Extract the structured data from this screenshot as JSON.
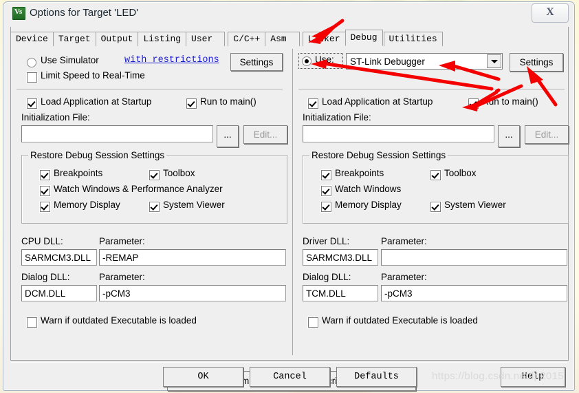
{
  "window": {
    "title": "Options for Target 'LED'",
    "icon": "keil-uvision-icon",
    "close_label": "X"
  },
  "tabs": [
    {
      "label": "Device",
      "selected": false
    },
    {
      "label": "Target",
      "selected": false
    },
    {
      "label": "Output",
      "selected": false
    },
    {
      "label": "Listing",
      "selected": false
    },
    {
      "label": "User",
      "selected": false
    },
    {
      "label": "C/C++",
      "selected": false
    },
    {
      "label": "Asm",
      "selected": false
    },
    {
      "label": "Linker",
      "selected": false
    },
    {
      "label": "Debug",
      "selected": true
    },
    {
      "label": "Utilities",
      "selected": false
    }
  ],
  "left": {
    "use_simulator_label": "Use Simulator",
    "use_simulator_checked": false,
    "restrictions_link": "with restrictions",
    "settings_button": "Settings",
    "limit_speed_label": "Limit Speed to Real-Time",
    "limit_speed_checked": false,
    "load_app_label": "Load Application at Startup",
    "load_app_checked": true,
    "run_to_main_label": "Run to main()",
    "run_to_main_checked": true,
    "init_file_label": "Initialization File:",
    "init_file_value": "",
    "browse_button": "...",
    "edit_button": "Edit...",
    "restore_group_title": "Restore Debug Session Settings",
    "restore_items": [
      {
        "label": "Breakpoints",
        "checked": true
      },
      {
        "label": "Toolbox",
        "checked": true
      },
      {
        "label": "Watch Windows & Performance Analyzer",
        "checked": true
      },
      {
        "label": "Memory Display",
        "checked": true
      },
      {
        "label": "System Viewer",
        "checked": true
      }
    ],
    "cpu_dll_label": "CPU DLL:",
    "cpu_dll_value": "SARMCM3.DLL",
    "cpu_param_label": "Parameter:",
    "cpu_param_value": "-REMAP",
    "dialog_dll_label": "Dialog DLL:",
    "dialog_dll_value": "DCM.DLL",
    "dialog_param_label": "Parameter:",
    "dialog_param_value": "-pCM3",
    "warn_label": "Warn if outdated Executable is loaded",
    "warn_checked": false
  },
  "right": {
    "use_label": "Use:",
    "use_checked": true,
    "debugger_selected": "ST-Link Debugger",
    "settings_button": "Settings",
    "load_app_label": "Load Application at Startup",
    "load_app_checked": true,
    "run_to_main_label": "Run to main()",
    "run_to_main_checked": true,
    "init_file_label": "Initialization File:",
    "init_file_value": "",
    "browse_button": "...",
    "edit_button": "Edit...",
    "restore_group_title": "Restore Debug Session Settings",
    "restore_items": [
      {
        "label": "Breakpoints",
        "checked": true
      },
      {
        "label": "Toolbox",
        "checked": true
      },
      {
        "label": "Watch Windows",
        "checked": true
      },
      {
        "label": "Memory Display",
        "checked": true
      },
      {
        "label": "System Viewer",
        "checked": true
      }
    ],
    "driver_dll_label": "Driver DLL:",
    "driver_dll_value": "SARMCM3.DLL",
    "driver_param_label": "Parameter:",
    "driver_param_value": "",
    "dialog_dll_label": "Dialog DLL:",
    "dialog_dll_value": "TCM.DLL",
    "dialog_param_label": "Parameter:",
    "dialog_param_value": "-pCM3",
    "warn_label": "Warn if outdated Executable is loaded",
    "warn_checked": false
  },
  "footer": {
    "manage_button": "Manage Component Viewer Description Files ...",
    "ok_button": "OK",
    "cancel_button": "Cancel",
    "defaults_button": "Defaults",
    "help_button": "Help"
  },
  "watermark": "https://blog.csdn.net/lp2015",
  "colors": {
    "annotation_red": "#f40000",
    "dialog_face": "#efefef",
    "link_blue": "#1a1ad0",
    "desktop": "#fdfbe8"
  }
}
